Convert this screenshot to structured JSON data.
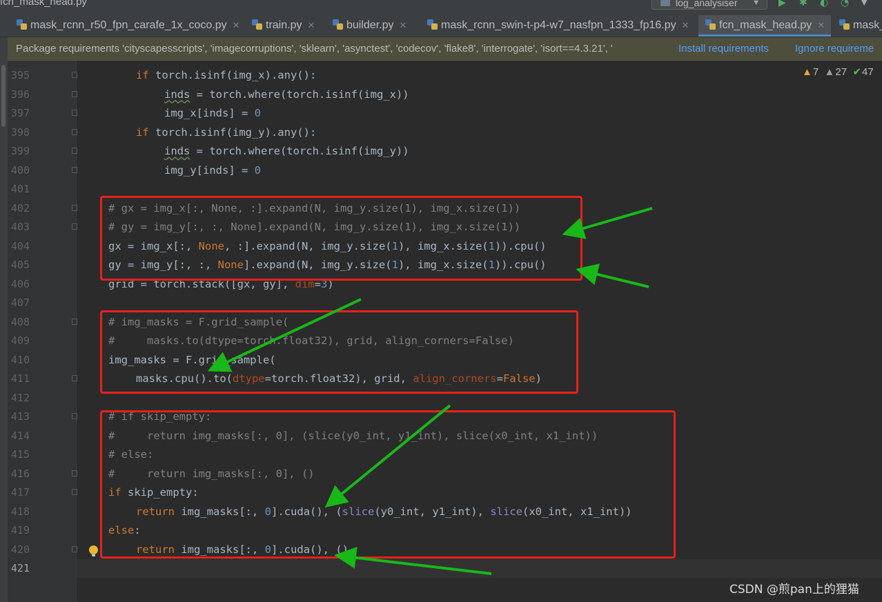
{
  "window": {
    "breadcrumb_file": "fcn_mask_head.py",
    "run_config": "log_analysiser"
  },
  "tabs": [
    {
      "label": "mask_rcnn_r50_fpn_carafe_1x_coco.py",
      "active": false
    },
    {
      "label": "train.py",
      "active": false
    },
    {
      "label": "builder.py",
      "active": false
    },
    {
      "label": "mask_rcnn_swin-t-p4-w7_nasfpn_1333_fp16.py",
      "active": false
    },
    {
      "label": "fcn_mask_head.py",
      "active": true
    },
    {
      "label": "mask_",
      "active": false
    }
  ],
  "banner": {
    "message": "Package requirements 'cityscapesscripts', 'imagecorruptions', 'sklearn', 'asynctest', 'codecov', 'flake8', 'interrogate', 'isort==4.3.21', '",
    "install_link": "Install requirements",
    "ignore_link": "Ignore requireme"
  },
  "inspections": {
    "warnings": "7",
    "weak_warnings": "27",
    "ok": "47"
  },
  "code_lines": [
    {
      "n": "395",
      "tokens": [
        [
          "if",
          "kw"
        ],
        [
          " torch.isinf(img_x).any():",
          ""
        ]
      ]
    },
    {
      "n": "396",
      "tokens": [
        [
          "inds",
          "ul"
        ],
        [
          " = torch.where(torch.isinf(img_x))",
          ""
        ]
      ]
    },
    {
      "n": "397",
      "tokens": [
        [
          "img_x[inds] = ",
          ""
        ],
        [
          "0",
          "num"
        ]
      ]
    },
    {
      "n": "398",
      "tokens": [
        [
          "if",
          "kw"
        ],
        [
          " torch.isinf(img_y).any():",
          ""
        ]
      ]
    },
    {
      "n": "399",
      "tokens": [
        [
          "inds",
          "ul"
        ],
        [
          " = torch.where(torch.isinf(img_y))",
          ""
        ]
      ]
    },
    {
      "n": "400",
      "tokens": [
        [
          "img_y[inds] = ",
          ""
        ],
        [
          "0",
          "num"
        ]
      ]
    },
    {
      "n": "401",
      "tokens": []
    },
    {
      "n": "402",
      "tokens": [
        [
          "# gx = img_x[:, None, :].expand(N, img_y.size(1), img_x.size(1))",
          "cm"
        ]
      ]
    },
    {
      "n": "403",
      "tokens": [
        [
          "# gy = img_y[:, :, None].expand(N, img_y.size(1), img_x.size(1))",
          "cm"
        ]
      ]
    },
    {
      "n": "404",
      "tokens": [
        [
          "gx = img_x[:, ",
          ""
        ],
        [
          "None",
          "kw"
        ],
        [
          ", :].expand(N, img_y.size(",
          ""
        ],
        [
          "1",
          "num"
        ],
        [
          "), img_x.size(",
          ""
        ],
        [
          "1",
          "num"
        ],
        [
          ")).cpu()",
          ""
        ]
      ]
    },
    {
      "n": "405",
      "tokens": [
        [
          "gy = img_y[:, :, ",
          ""
        ],
        [
          "None",
          "kw"
        ],
        [
          "].expand(N, img_y.size(",
          ""
        ],
        [
          "1",
          "num"
        ],
        [
          "), img_x.size(",
          ""
        ],
        [
          "1",
          "num"
        ],
        [
          ")).cpu()",
          ""
        ]
      ]
    },
    {
      "n": "406",
      "tokens": [
        [
          "grid = torch.stack([gx, gy], ",
          ""
        ],
        [
          "dim",
          "par"
        ],
        [
          "=",
          ""
        ],
        [
          "3",
          "num"
        ],
        [
          ")",
          ""
        ]
      ]
    },
    {
      "n": "407",
      "tokens": []
    },
    {
      "n": "408",
      "tokens": [
        [
          "# img_masks = F.grid_sample(",
          "cm"
        ]
      ]
    },
    {
      "n": "409",
      "tokens": [
        [
          "#     masks.to(dtype=torch.float32), grid, align_corners=False)",
          "cm"
        ]
      ]
    },
    {
      "n": "410",
      "tokens": [
        [
          "img_masks = F.grid_sample(",
          ""
        ]
      ]
    },
    {
      "n": "411",
      "tokens": [
        [
          "masks.cpu().to(",
          ""
        ],
        [
          "dtype",
          "par"
        ],
        [
          "=torch.float32), grid, ",
          ""
        ],
        [
          "align_corners",
          "par"
        ],
        [
          "=",
          ""
        ],
        [
          "False",
          "kw"
        ],
        [
          ")",
          ""
        ]
      ]
    },
    {
      "n": "412",
      "tokens": []
    },
    {
      "n": "413",
      "tokens": [
        [
          "# if skip_empty:",
          "cm"
        ]
      ]
    },
    {
      "n": "414",
      "tokens": [
        [
          "#     return img_masks[:, 0], (slice(y0_int, y1_int), slice(x0_int, x1_int))",
          "cm"
        ]
      ]
    },
    {
      "n": "415",
      "tokens": [
        [
          "# else:",
          "cm"
        ]
      ]
    },
    {
      "n": "416",
      "tokens": [
        [
          "#     return img_masks[:, 0], ()",
          "cm"
        ]
      ]
    },
    {
      "n": "417",
      "tokens": [
        [
          "if",
          "kw"
        ],
        [
          " skip_empty:",
          ""
        ]
      ]
    },
    {
      "n": "418",
      "tokens": [
        [
          "return",
          "kw"
        ],
        [
          " img_masks[:, ",
          ""
        ],
        [
          "0",
          "num"
        ],
        [
          "].cuda(), (",
          ""
        ],
        [
          "slice",
          "bi"
        ],
        [
          "(y0_int, y1_int), ",
          ""
        ],
        [
          "slice",
          "bi"
        ],
        [
          "(x0_int, x1_int))",
          ""
        ]
      ]
    },
    {
      "n": "419",
      "tokens": [
        [
          "else",
          "kw"
        ],
        [
          ":",
          ""
        ]
      ]
    },
    {
      "n": "420",
      "tokens": [
        [
          "return",
          "kw"
        ],
        [
          " img_masks[:, ",
          ""
        ],
        [
          "0",
          "num"
        ],
        [
          "].cuda(), ()",
          ""
        ]
      ]
    },
    {
      "n": "421",
      "tokens": []
    }
  ],
  "watermark": "CSDN @煎pan上的狸猫"
}
